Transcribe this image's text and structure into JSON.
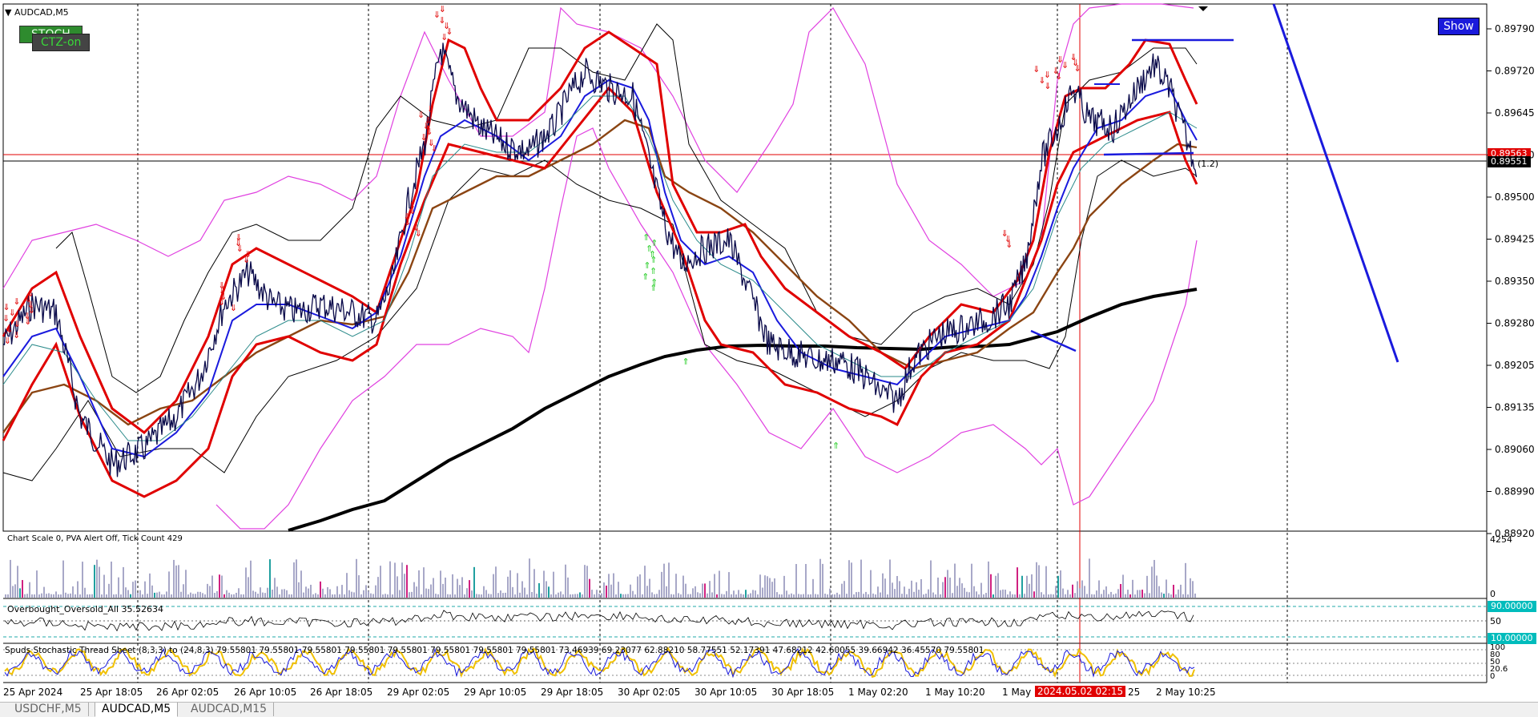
{
  "window": {
    "title": "AUDCAD,M5"
  },
  "indicators": {
    "stoch_badge": "STOCH",
    "ct_badge": "CTZ-on",
    "show_button": "Show"
  },
  "main_chart": {
    "price_ticks": [
      "0.89790",
      "0.89720",
      "0.89645",
      "0.89570",
      "0.89500",
      "0.89425",
      "0.89350",
      "0.89280",
      "0.89205",
      "0.89135",
      "0.89060",
      "0.88990",
      "0.88920"
    ],
    "red_price_tag": "0.89563",
    "black_price_tag": "0.89551",
    "annotation": "(1.2)"
  },
  "volume_pane": {
    "label": "Chart Scale  0,   PVA Alert Off,   Tick Count  429",
    "max_tick": "4254",
    "min_tick": "0"
  },
  "obos_pane": {
    "label": "Overbought_Oversold_All 35.52634",
    "tick_upper": "90.00000",
    "tick_mid": "50",
    "tick_lower": "10.00000"
  },
  "stoch_pane": {
    "label": "Spuds Stochastic Thread Sheet (8,3,3) to (24,8,3) 79.55801 79.55801 79.55801 79.55801 79.55801 79.55801 79.55801 79.55801 73.46939 69.23077 62.88210 58.77551 52.17391 47.68212 42.60055 39.66942 36.45570 79.55801",
    "ticks": [
      "100",
      "80",
      "50",
      "20.6",
      "0"
    ]
  },
  "time_axis": {
    "labels": [
      "25 Apr 2024",
      "25 Apr 18:05",
      "26 Apr 02:05",
      "26 Apr 10:05",
      "26 Apr 18:05",
      "29 Apr 02:05",
      "29 Apr 10:05",
      "29 Apr 18:05",
      "30 Apr 02:05",
      "30 Apr 10:05",
      "30 Apr 18:05",
      "1 May 02:20",
      "1 May 10:20",
      "1 May",
      "25",
      "2 May 10:25"
    ],
    "cursor_label": "2024.05.02 02:15"
  },
  "tabs": [
    {
      "label": "USDCHF,M5"
    },
    {
      "label": "AUDCAD,M5"
    },
    {
      "label": "AUDCAD,M15"
    }
  ],
  "colors": {
    "price_line": "#0a0a4a",
    "envelope_red": "#e00000",
    "ma_black": "#000000",
    "bands_magenta": "#e040e0",
    "trendline_blue": "#1a1add",
    "ma_brown": "#8b4513",
    "cursor_red": "#e00000"
  }
}
